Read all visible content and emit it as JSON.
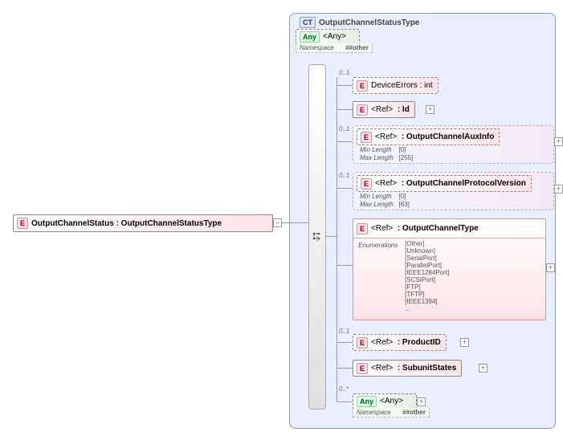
{
  "root": {
    "badge": "E",
    "label": "OutputChannelStatus : OutputChannelStatusType"
  },
  "ct": {
    "badge": "CT",
    "title": "OutputChannelStatusType"
  },
  "any_top": {
    "badge": "Any",
    "label": "<Any>",
    "ns_label": "Namespace",
    "ns_value": "##other"
  },
  "seq_badge": "⋮",
  "children": {
    "device": {
      "badge": "E",
      "label": "DeviceErrors : int",
      "occ": "0..1"
    },
    "id": {
      "badge": "E",
      "ref": "<Ref>",
      "name": ": Id"
    },
    "aux": {
      "badge": "E",
      "ref": "<Ref>",
      "name": ": OutputChannelAuxInfo",
      "occ": "0..1",
      "minlbl": "Min Length",
      "minval": "[0]",
      "maxlbl": "Max Length",
      "maxval": "[255]"
    },
    "proto": {
      "badge": "E",
      "ref": "<Ref>",
      "name": ": OutputChannelProtocolVersion",
      "occ": "0..1",
      "minlbl": "Min Length",
      "minval": "[0]",
      "maxlbl": "Max Length",
      "maxval": "[63]"
    },
    "type": {
      "badge": "E",
      "ref": "<Ref>",
      "name": ": OutputChannelType",
      "enumlbl": "Enumerations",
      "enums": [
        "[Other]",
        "[Unknown]",
        "[SerialPort]",
        "[ParallelPort]",
        "[IEEE1284Port]",
        "[SCSIPort]",
        "[FTP]",
        "[TFTP]",
        "[IEEE1394]",
        "..."
      ]
    },
    "product": {
      "badge": "E",
      "ref": "<Ref>",
      "name": ": ProductID",
      "occ": "0..1"
    },
    "states": {
      "badge": "E",
      "ref": "<Ref>",
      "name": ": SubunitStates"
    },
    "any_bot": {
      "badge": "Any",
      "label": "<Any>",
      "ns_label": "Namespace",
      "ns_value": "##other",
      "occ": "0..*"
    }
  }
}
